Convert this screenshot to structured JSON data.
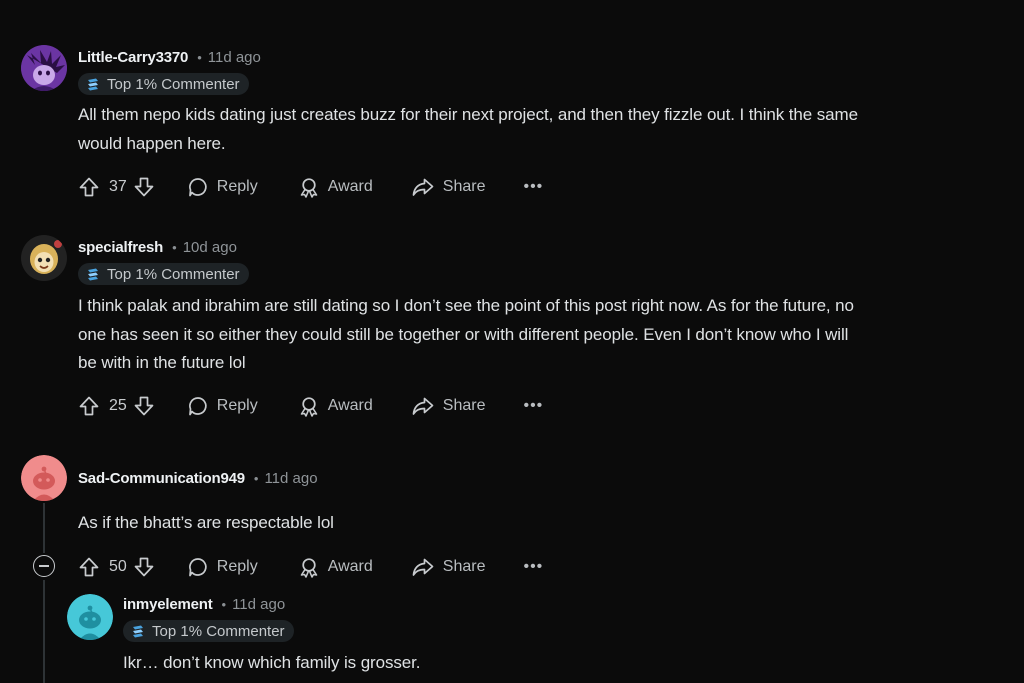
{
  "comments": [
    {
      "author": "Little-Carry3370",
      "time": "11d ago",
      "flair": "Top 1% Commenter",
      "body_lines": [
        "All them nepo kids dating just creates buzz for their next project, and then they fizzle out. I think the same",
        "would happen here."
      ],
      "votes": "37",
      "avatar": "purple-character-avatar"
    },
    {
      "author": "specialfresh",
      "time": "10d ago",
      "flair": "Top 1% Commenter",
      "body_lines": [
        "I think palak and ibrahim are still dating so I don’t see the point of this post right now. As for the future, no",
        "one has seen it so either they could still be together or with different people. Even I don’t know who I will",
        "be with in the future lol"
      ],
      "votes": "25",
      "avatar": "cartoon-character-avatar"
    },
    {
      "author": "Sad-Communication949",
      "time": "11d ago",
      "flair": "",
      "body_lines": [
        "As if the bhatt’s are respectable lol"
      ],
      "votes": "50",
      "avatar": "default-snoo-avatar-pink"
    },
    {
      "author": "inmyelement",
      "time": "11d ago",
      "flair": "Top 1% Commenter",
      "body_lines": [
        "Ikr… don’t know which family is grosser."
      ],
      "avatar": "default-snoo-avatar-teal"
    }
  ],
  "actions": {
    "reply": "Reply",
    "award": "Award",
    "share": "Share",
    "more": "•••"
  },
  "colors": {
    "background": "#0b0b0b",
    "flair_bg": "#1e2326",
    "snoo_pink": "#f08c8c",
    "snoo_teal": "#46c8d8"
  }
}
